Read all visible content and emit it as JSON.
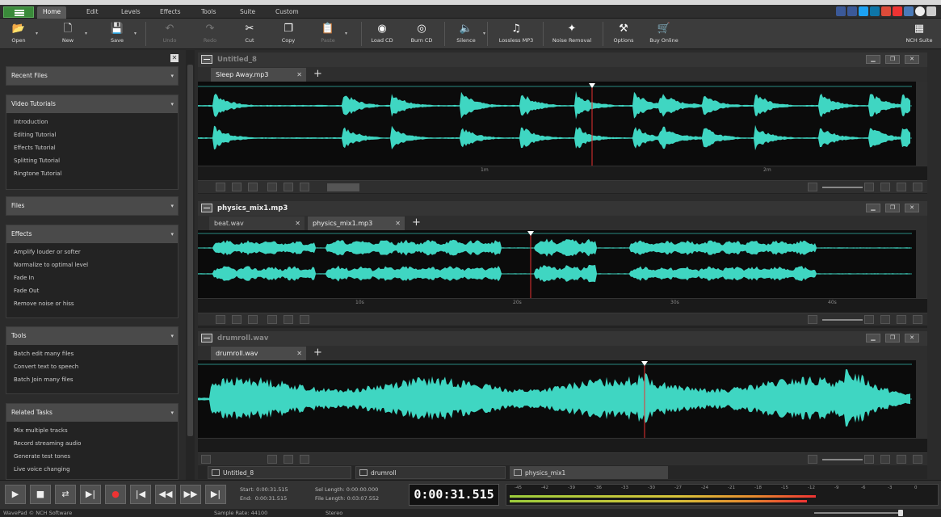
{
  "ribbon_tabs": [
    "Home",
    "Edit",
    "Levels",
    "Effects",
    "Tools",
    "Suite",
    "Custom"
  ],
  "active_tab": "Home",
  "ribbon": {
    "open": "Open",
    "new": "New",
    "save": "Save",
    "undo": "Undo",
    "redo": "Redo",
    "cut": "Cut",
    "copy": "Copy",
    "paste": "Paste",
    "load_cd": "Load CD",
    "burn_cd": "Burn CD",
    "silence": "Silence",
    "lossless_mp3": "Lossless MP3",
    "noise_removal": "Noise Removal",
    "options": "Options",
    "buy_online": "Buy Online",
    "nch_suite": "NCH Suite"
  },
  "sidebar": {
    "recent_files": "Recent Files",
    "video_tutorials": {
      "title": "Video Tutorials",
      "items": [
        "Introduction",
        "Editing Tutorial",
        "Effects Tutorial",
        "Splitting Tutorial",
        "Ringtone Tutorial"
      ]
    },
    "files": "Files",
    "effects": {
      "title": "Effects",
      "items": [
        "Amplify louder or softer",
        "Normalize to optimal level",
        "Fade In",
        "Fade Out",
        "Remove noise or hiss"
      ]
    },
    "tools": {
      "title": "Tools",
      "items": [
        "Batch edit many files",
        "Convert text to speech",
        "Batch Join many files"
      ]
    },
    "related": {
      "title": "Related Tasks",
      "items": [
        "Mix multiple tracks",
        "Record streaming audio",
        "Generate test tones",
        "Live voice changing"
      ]
    }
  },
  "panels": {
    "p1": {
      "title": "Untitled_8",
      "tab1": "Sleep Away.mp3",
      "ruler": [
        "1m",
        "2m"
      ]
    },
    "p2": {
      "title": "physics_mix1.mp3",
      "tab1": "beat.wav",
      "tab2": "physics_mix1.mp3",
      "ruler": [
        "10s",
        "20s",
        "30s",
        "40s"
      ]
    },
    "p3": {
      "title": "drumroll.wav",
      "tab1": "drumroll.wav"
    }
  },
  "bottom_tabs": [
    "Untitled_8",
    "drumroll",
    "physics_mix1"
  ],
  "transport": {
    "start_label": "Start:",
    "start": "0:00:31.515",
    "end_label": "End:",
    "end": "0:00:31.515",
    "sel_length_label": "Sel Length:",
    "sel_length": "0:00:00.000",
    "file_length_label": "File Length:",
    "file_length": "0:03:07.552",
    "time": "0:00:31.515"
  },
  "meter_labels": [
    "-45",
    "-42",
    "-39",
    "-36",
    "-33",
    "-30",
    "-27",
    "-24",
    "-21",
    "-18",
    "-15",
    "-12",
    "-9",
    "-6",
    "-3",
    "0"
  ],
  "meter_levels": {
    "left": 0.72,
    "right": 0.7
  },
  "status": {
    "app": "WavePad © NCH Software",
    "sample_rate": "Sample Rate: 44100",
    "channels": "Stereo"
  },
  "colors": {
    "wave": "#3fd6c2",
    "playhead": "#e83030",
    "accent": "#3a8a3a"
  }
}
